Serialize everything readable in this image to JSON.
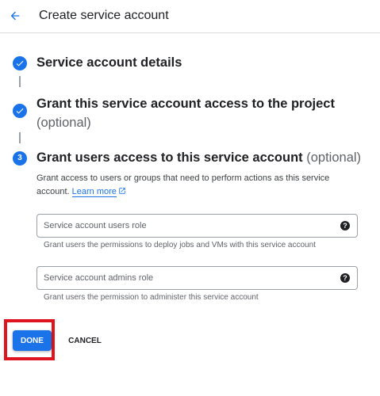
{
  "header": {
    "title": "Create service account",
    "back_icon": "arrow-left-icon"
  },
  "accent_color": "#1a73e8",
  "steps": [
    {
      "status": "completed",
      "icon": "check-icon",
      "title": "Service account details",
      "optional": ""
    },
    {
      "status": "completed",
      "icon": "check-icon",
      "title": "Grant this service account access to the project",
      "optional": "(optional)"
    },
    {
      "status": "active",
      "number": "3",
      "title": "Grant users access to this service account",
      "optional": "(optional)"
    }
  ],
  "step3": {
    "description": "Grant access to users or groups that need to perform actions as this service account.",
    "learn_more": "Learn more",
    "fields": [
      {
        "placeholder": "Service account users role",
        "hint": "Grant users the permissions to deploy jobs and VMs with this service account",
        "help_icon": "help-circle-icon"
      },
      {
        "placeholder": "Service account admins role",
        "hint": "Grant users the permission to administer this service account",
        "help_icon": "help-circle-icon"
      }
    ]
  },
  "actions": {
    "done_label": "DONE",
    "cancel_label": "CANCEL",
    "highlight_color": "#e0141e"
  }
}
